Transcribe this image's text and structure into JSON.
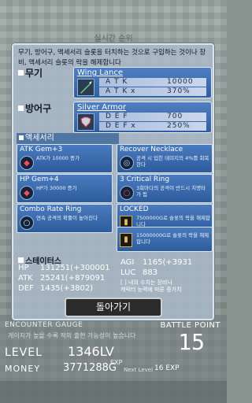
{
  "background": {
    "top_title": "실시간 순위",
    "encounter_label": "ENCOUNTER GAUGE",
    "encounter_desc": "게이지가 높을 수록 적의 출현 가능성이 높습니다",
    "battle_point_label": "BATTLE POINT",
    "battle_point_value": "15",
    "level_label": "LEVEL",
    "level_value": "1346LV",
    "money_label": "MONEY",
    "money_value": "3771288G",
    "exp_label": "EXP",
    "next_level_label": "Next Level",
    "next_level_exp": "16 EXP"
  },
  "modal": {
    "description": "무기, 방어구, 액세서리 슬롯을 터치하는 것으로 구입하는 것이나 장비, 액세서리 슬롯의 락을 해제합니다",
    "weapon": {
      "section_label": "무기",
      "name": "Wing Lance",
      "stat1_key": "A T K",
      "stat1_value": "10000",
      "stat2_key": "A T K  x",
      "stat2_value": "370%",
      "icon": "lance-icon"
    },
    "armor": {
      "section_label": "방어구",
      "name": "Silver Armor",
      "stat1_key": "D E F",
      "stat1_value": "700",
      "stat2_key": "D E F  x",
      "stat2_value": "250%",
      "icon": "armor-icon"
    },
    "accessory_section_label": "액세서리",
    "accessories": [
      {
        "name": "ATK Gem+3",
        "desc": "ATK가 10000 증가"
      },
      {
        "name": "Recover Necklace",
        "desc": "공격 시 입힌 데미지의 4%를 회복한다"
      },
      {
        "name": "HP Gem+4",
        "desc": "HP가 30000 증가"
      },
      {
        "name": "3 Critical Ring",
        "desc": "3회마다의 공격이 반드시 치명타가 됨"
      },
      {
        "name": "Combo Rate Ring",
        "desc": "연속 공격의 확률이 높아진다"
      },
      {
        "name": "LOCKED",
        "desc": "7500000G로 슬롯의 락을 해제합니다"
      },
      {
        "name": "",
        "desc": "15000000G로 슬롯의 락을 해제합니다"
      }
    ],
    "status": {
      "section_label": "스테이터스",
      "hp_label": "HP",
      "hp_value": "131251(+300001",
      "atk_label": "ATK",
      "atk_value": "25241(+879091",
      "def_label": "DEF",
      "def_value": "1435(+3802)",
      "agi_label": "AGI",
      "agi_value": "1165(+3931",
      "luc_label": "LUC",
      "luc_value": "883",
      "note1": "[ ] 내의 수치는 장비나",
      "note2": "캐릭터 능력에 따른 증가치"
    },
    "back_button": "돌아가기"
  }
}
